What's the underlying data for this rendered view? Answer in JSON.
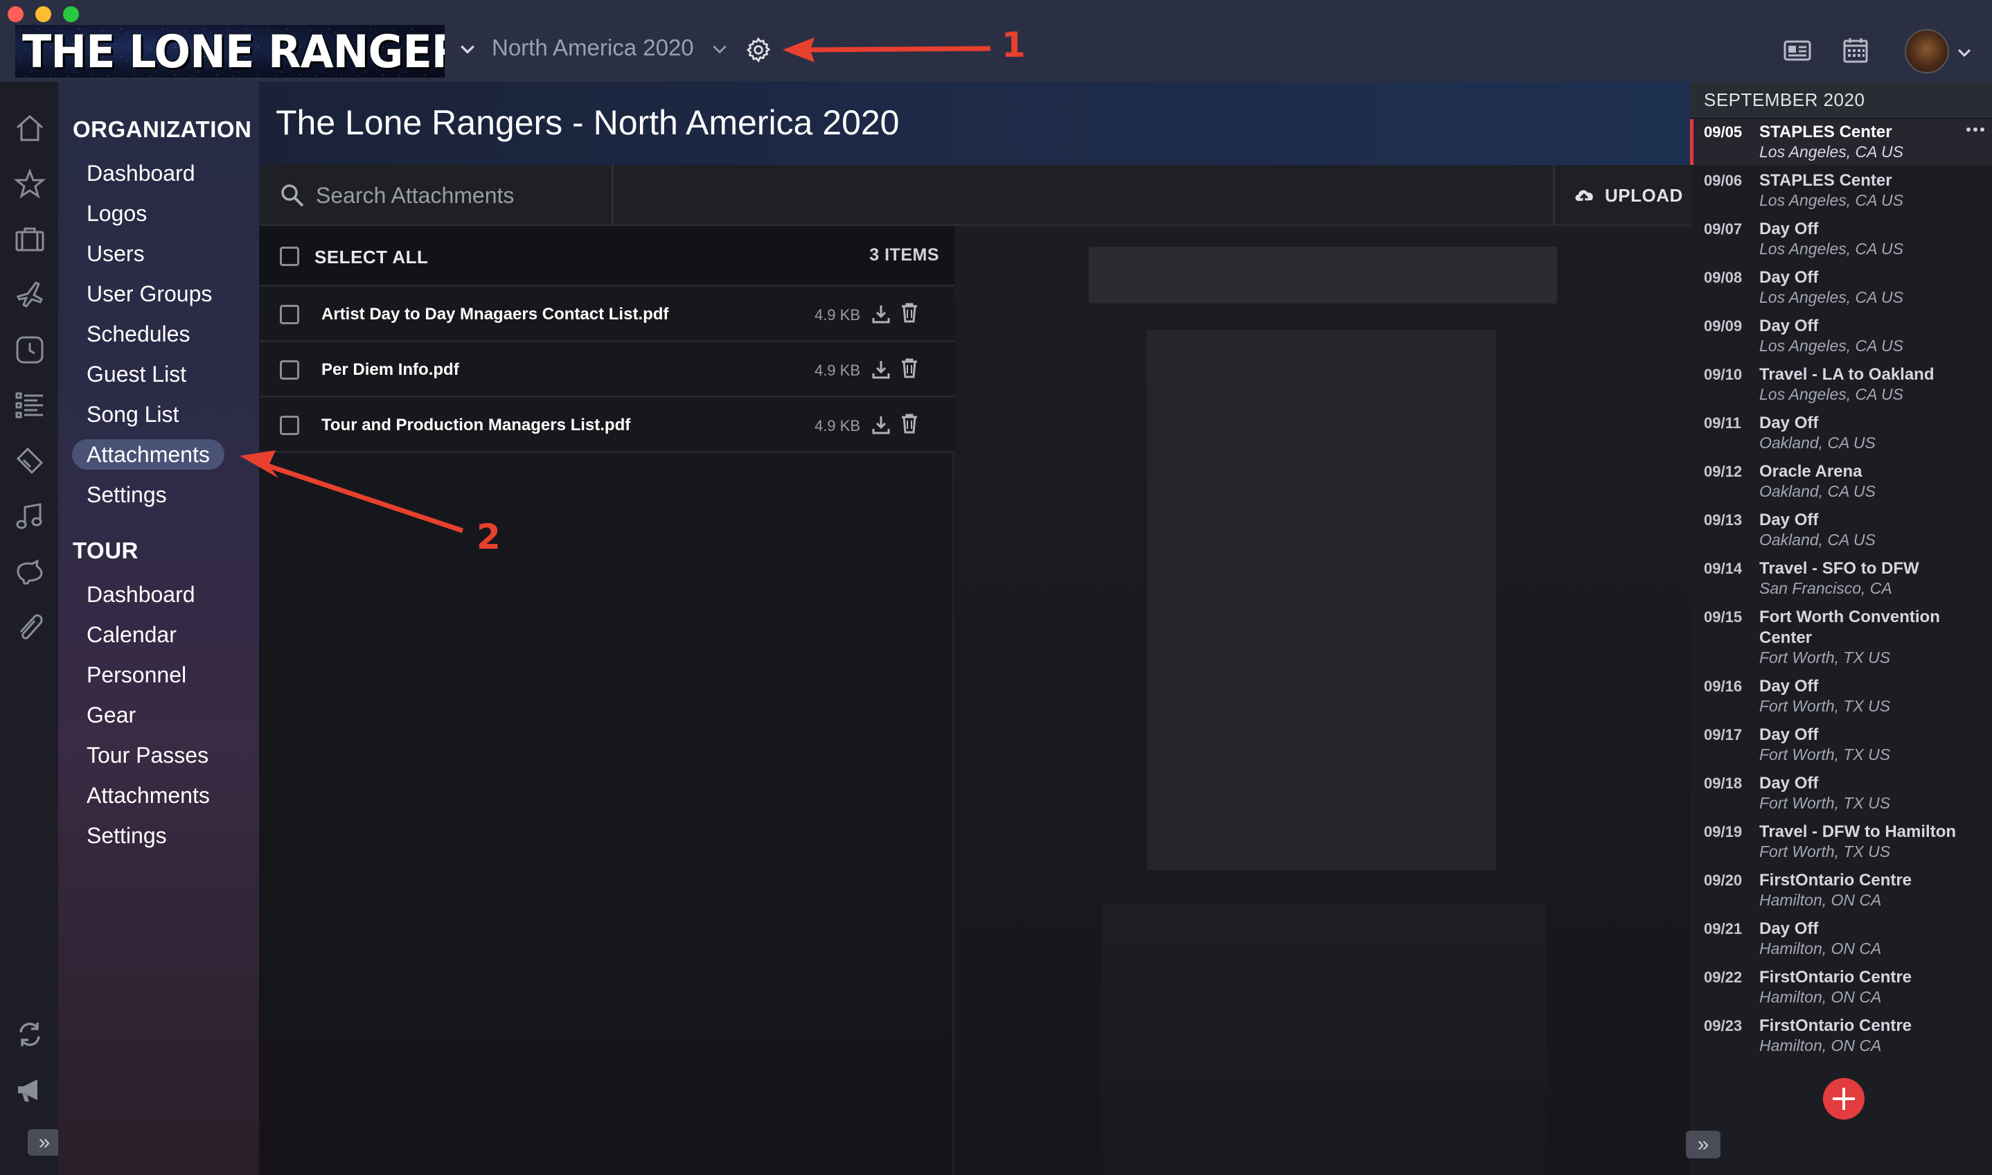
{
  "window": {
    "controls": [
      "close",
      "minimize",
      "maximize"
    ]
  },
  "header": {
    "logo_text": "THE LONE RANGERS",
    "tour_select": "North America 2020",
    "icons": [
      "chevron-down-icon",
      "gear-icon",
      "contact-card-icon",
      "calendar-icon",
      "user-avatar"
    ]
  },
  "annotations": {
    "one": "1",
    "two": "2",
    "color": "#e8402f"
  },
  "nav": {
    "organization_heading": "ORGANIZATION",
    "organization_items": [
      "Dashboard",
      "Logos",
      "Users",
      "User Groups",
      "Schedules",
      "Guest List",
      "Song List",
      "Attachments",
      "Settings"
    ],
    "active_item": "Attachments",
    "tour_heading": "TOUR",
    "tour_items": [
      "Dashboard",
      "Calendar",
      "Personnel",
      "Gear",
      "Tour Passes",
      "Attachments",
      "Settings"
    ]
  },
  "page": {
    "title": "The Lone Rangers - North America 2020"
  },
  "toolbar": {
    "search_placeholder": "Search Attachments",
    "upload_label": "UPLOAD"
  },
  "list": {
    "select_all_label": "SELECT ALL",
    "item_count": "3 ITEMS",
    "files": [
      {
        "name": "Artist Day to Day Mnagaers Contact List.pdf",
        "size": "4.9 KB"
      },
      {
        "name": "Per Diem Info.pdf",
        "size": "4.9 KB"
      },
      {
        "name": "Tour and Production Managers List.pdf",
        "size": "4.9 KB"
      }
    ]
  },
  "schedule": {
    "month": "SEPTEMBER 2020",
    "days": [
      {
        "date": "09/05",
        "title": "STAPLES Center",
        "location": "Los Angeles, CA US"
      },
      {
        "date": "09/06",
        "title": "STAPLES Center",
        "location": "Los Angeles, CA US"
      },
      {
        "date": "09/07",
        "title": "Day Off",
        "location": "Los Angeles, CA US"
      },
      {
        "date": "09/08",
        "title": "Day Off",
        "location": "Los Angeles, CA US"
      },
      {
        "date": "09/09",
        "title": "Day Off",
        "location": "Los Angeles, CA US"
      },
      {
        "date": "09/10",
        "title": "Travel - LA to Oakland",
        "location": "Los Angeles, CA US"
      },
      {
        "date": "09/11",
        "title": "Day Off",
        "location": "Oakland, CA US"
      },
      {
        "date": "09/12",
        "title": "Oracle Arena",
        "location": "Oakland, CA US"
      },
      {
        "date": "09/13",
        "title": "Day Off",
        "location": "Oakland, CA US"
      },
      {
        "date": "09/14",
        "title": "Travel - SFO to DFW",
        "location": "San Francisco, CA"
      },
      {
        "date": "09/15",
        "title": "Fort Worth Convention Center",
        "location": "Fort Worth, TX US"
      },
      {
        "date": "09/16",
        "title": "Day Off",
        "location": "Fort Worth, TX US"
      },
      {
        "date": "09/17",
        "title": "Day Off",
        "location": "Fort Worth, TX US"
      },
      {
        "date": "09/18",
        "title": "Day Off",
        "location": "Fort Worth, TX US"
      },
      {
        "date": "09/19",
        "title": "Travel - DFW to Hamilton",
        "location": "Fort Worth, TX US"
      },
      {
        "date": "09/20",
        "title": "FirstOntario Centre",
        "location": "Hamilton, ON CA"
      },
      {
        "date": "09/21",
        "title": "Day Off",
        "location": "Hamilton, ON CA"
      },
      {
        "date": "09/22",
        "title": "FirstOntario Centre",
        "location": "Hamilton, ON CA"
      },
      {
        "date": "09/23",
        "title": "FirstOntario Centre",
        "location": "Hamilton, ON CA"
      }
    ],
    "active_date": "09/05"
  },
  "colors": {
    "accent_red": "#e23c3f",
    "nav_active": "#4a5276",
    "topbar": "#2b2f43"
  }
}
